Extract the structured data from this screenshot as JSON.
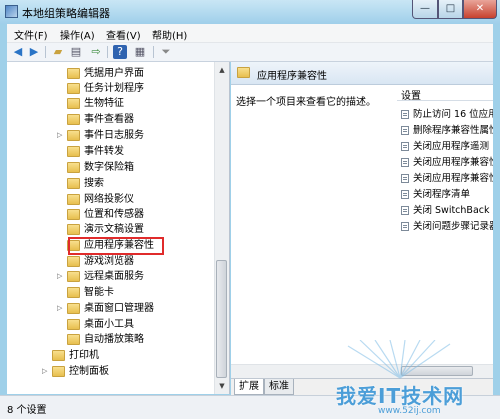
{
  "window": {
    "title": "本地组策略编辑器",
    "controls": {
      "minimize": "—",
      "maximize": "□",
      "close": "✕"
    }
  },
  "menu": {
    "items": [
      "文件(F)",
      "操作(A)",
      "查看(V)",
      "帮助(H)"
    ]
  },
  "toolbar": {
    "icons": [
      "back-arrow-icon",
      "forward-arrow-icon",
      "folder-up-icon",
      "show-hide-tree-icon",
      "export-icon",
      "help-icon",
      "properties-icon",
      "filter-icon"
    ]
  },
  "tree": {
    "items": [
      {
        "label": "凭据用户界面",
        "expandable": false
      },
      {
        "label": "任务计划程序",
        "expandable": false
      },
      {
        "label": "生物特征",
        "expandable": false
      },
      {
        "label": "事件查看器",
        "expandable": false
      },
      {
        "label": "事件日志服务",
        "expandable": true
      },
      {
        "label": "事件转发",
        "expandable": false
      },
      {
        "label": "数字保险箱",
        "expandable": false
      },
      {
        "label": "搜索",
        "expandable": false
      },
      {
        "label": "网络投影仪",
        "expandable": false
      },
      {
        "label": "位置和传感器",
        "expandable": false
      },
      {
        "label": "演示文稿设置",
        "expandable": false
      },
      {
        "label": "应用程序兼容性",
        "expandable": false,
        "selected": true
      },
      {
        "label": "游戏浏览器",
        "expandable": false
      },
      {
        "label": "远程桌面服务",
        "expandable": true
      },
      {
        "label": "智能卡",
        "expandable": false
      },
      {
        "label": "桌面窗口管理器",
        "expandable": true
      },
      {
        "label": "桌面小工具",
        "expandable": false
      },
      {
        "label": "自动播放策略",
        "expandable": false
      }
    ],
    "parent_items": [
      {
        "label": "打印机",
        "expandable": false
      },
      {
        "label": "控制面板",
        "expandable": true
      }
    ]
  },
  "right_pane": {
    "header": "应用程序兼容性",
    "description": "选择一个项目来查看它的描述。",
    "column_header": "设置",
    "settings": [
      "防止访问 16 位应用",
      "删除程序兼容性属性",
      "关闭应用程序遥测",
      "关闭应用程序兼容性",
      "关闭应用程序兼容性助手",
      "关闭程序清单",
      "关闭 SwitchBack 兼",
      "关闭问题步骤记录器"
    ]
  },
  "tabs": [
    "扩展",
    "标准"
  ],
  "status": {
    "text": "8 个设置"
  },
  "watermark": {
    "text": "我爱IT技术网",
    "url": "www.52ij.com"
  },
  "colors": {
    "selection_box": "#e02b2b",
    "title_bar": "#9fcfea",
    "folder": "#e7bf4e"
  }
}
